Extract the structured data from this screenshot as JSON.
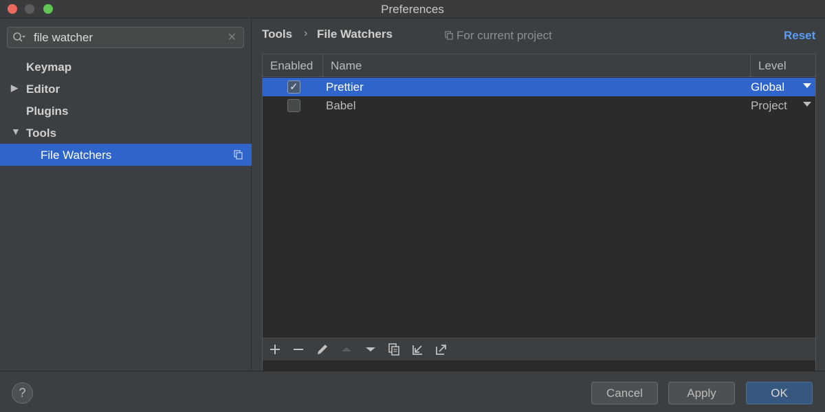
{
  "window": {
    "title": "Preferences"
  },
  "search": {
    "value": "file watcher"
  },
  "tree": [
    {
      "label": "Keymap"
    },
    {
      "label": "Editor"
    },
    {
      "label": "Plugins"
    },
    {
      "label": "Tools"
    },
    {
      "label": "File Watchers"
    }
  ],
  "breadcrumb": {
    "root": "Tools",
    "separator": "›",
    "current": "File Watchers"
  },
  "scope_note": "For current project",
  "reset_label": "Reset",
  "table": {
    "columns": [
      "Enabled",
      "Name",
      "Level"
    ],
    "rows": [
      {
        "enabled": true,
        "check": "✓",
        "name": "Prettier",
        "level": "Global"
      },
      {
        "enabled": false,
        "name": "Babel",
        "level": "Project"
      }
    ]
  },
  "footer": {
    "help": "?",
    "cancel": "Cancel",
    "apply": "Apply",
    "ok": "OK"
  },
  "colors": {
    "accent": "#2f65ca",
    "link": "#589df6",
    "background": "#3c3f41",
    "table_bg": "#2b2b2b"
  }
}
